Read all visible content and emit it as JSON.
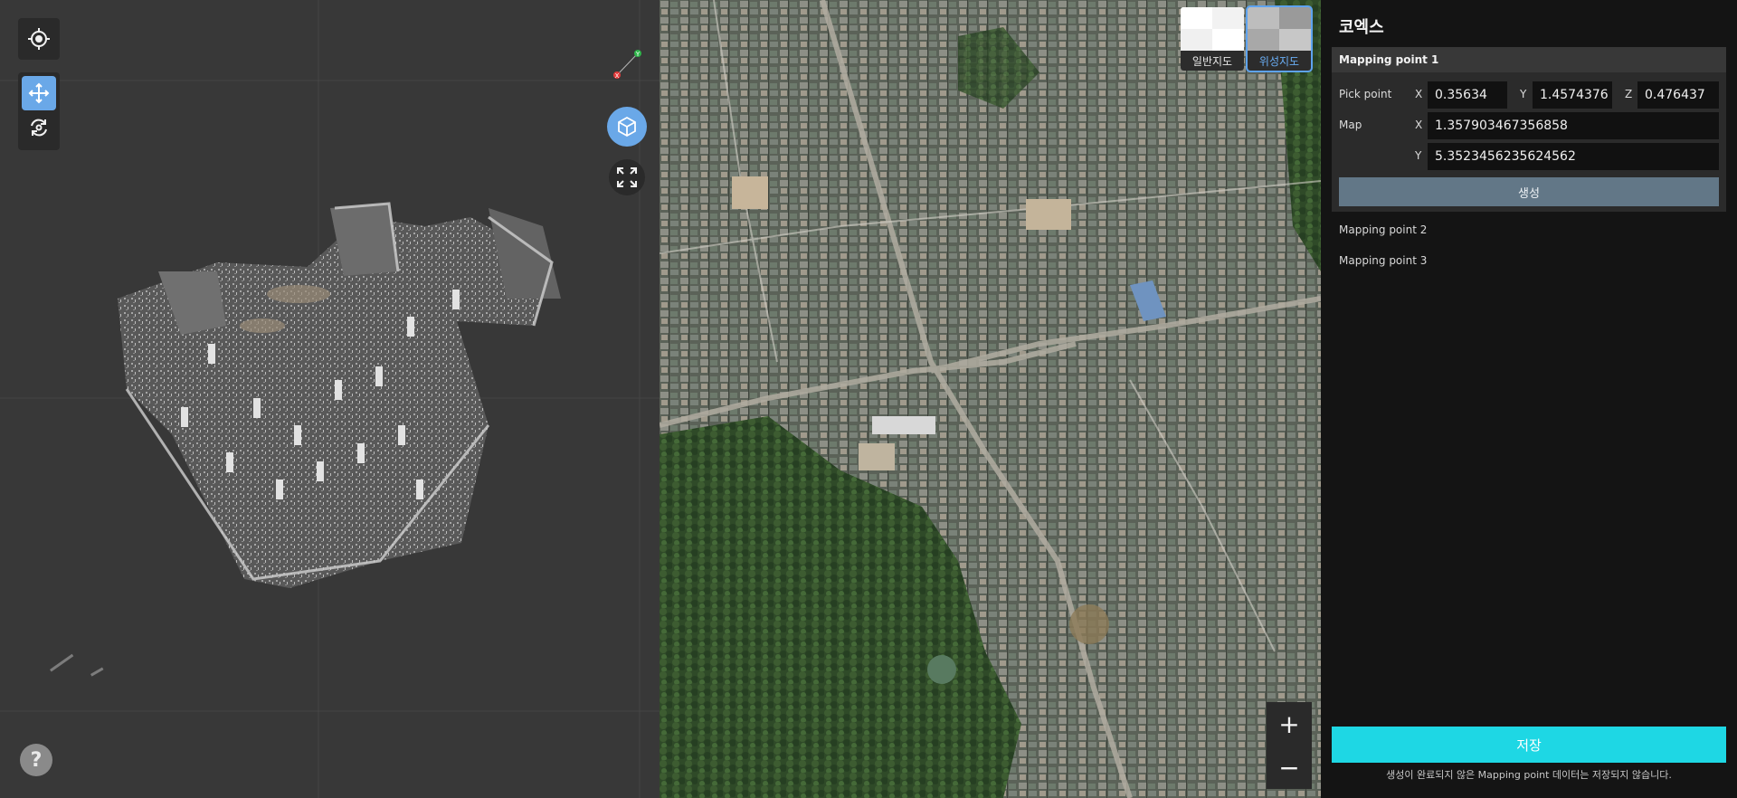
{
  "viewer": {
    "icons": {
      "locate": "crosshair-icon",
      "move": "move-arrows-icon",
      "rotate": "rotate-icon",
      "view3d": "cube-icon",
      "fullscreen": "expand-icon",
      "help": "question-icon"
    },
    "axis_x": "X",
    "axis_y": "Y",
    "help_label": "?"
  },
  "map": {
    "types": [
      {
        "label": "일반지도",
        "selected": false
      },
      {
        "label": "위성지도",
        "selected": true
      }
    ],
    "zoom_in": "+",
    "zoom_out": "−"
  },
  "panel": {
    "title": "코엑스",
    "active_point": {
      "header": "Mapping point 1",
      "pick_label": "Pick point",
      "pick": {
        "x_label": "X",
        "x": "0.35634",
        "y_label": "Y",
        "y": "1.4574376",
        "z_label": "Z",
        "z": "0.476437"
      },
      "map_label": "Map",
      "map": {
        "x_label": "X",
        "x": "1.357903467356858",
        "y_label": "Y",
        "y": "5.3523456235624562"
      },
      "generate": "생성"
    },
    "points": [
      "Mapping point 2",
      "Mapping point 3"
    ],
    "save": "저장",
    "note": "생성이 완료되지 않은 Mapping point 데이터는 저장되지 않습니다."
  },
  "colors": {
    "accent": "#6aa8e8",
    "save": "#1ed7e4",
    "generate": "#627787"
  }
}
